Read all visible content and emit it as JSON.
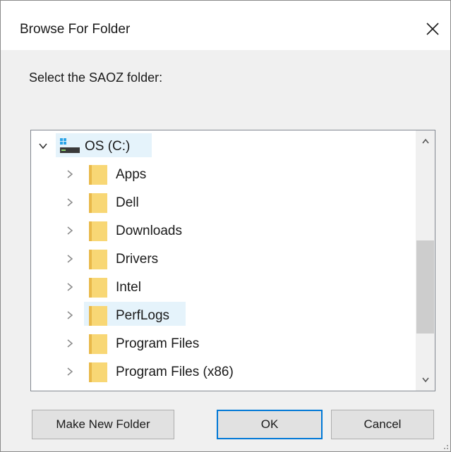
{
  "window": {
    "title": "Browse For Folder",
    "close_glyph": "✕"
  },
  "prompt": "Select the SAOZ folder:",
  "tree": {
    "root": {
      "label": "OS (C:)",
      "icon": "drive-icon",
      "expanded": true
    },
    "items": [
      {
        "label": "Apps"
      },
      {
        "label": "Dell"
      },
      {
        "label": "Downloads"
      },
      {
        "label": "Drivers"
      },
      {
        "label": "Intel"
      },
      {
        "label": "PerfLogs"
      },
      {
        "label": "Program Files"
      },
      {
        "label": "Program Files (x86)"
      }
    ]
  },
  "buttons": {
    "make_new_folder": "Make New Folder",
    "ok": "OK",
    "cancel": "Cancel"
  },
  "colors": {
    "accent": "#0078d7",
    "selection": "#e5f3fb",
    "folder": "#f8d775"
  }
}
